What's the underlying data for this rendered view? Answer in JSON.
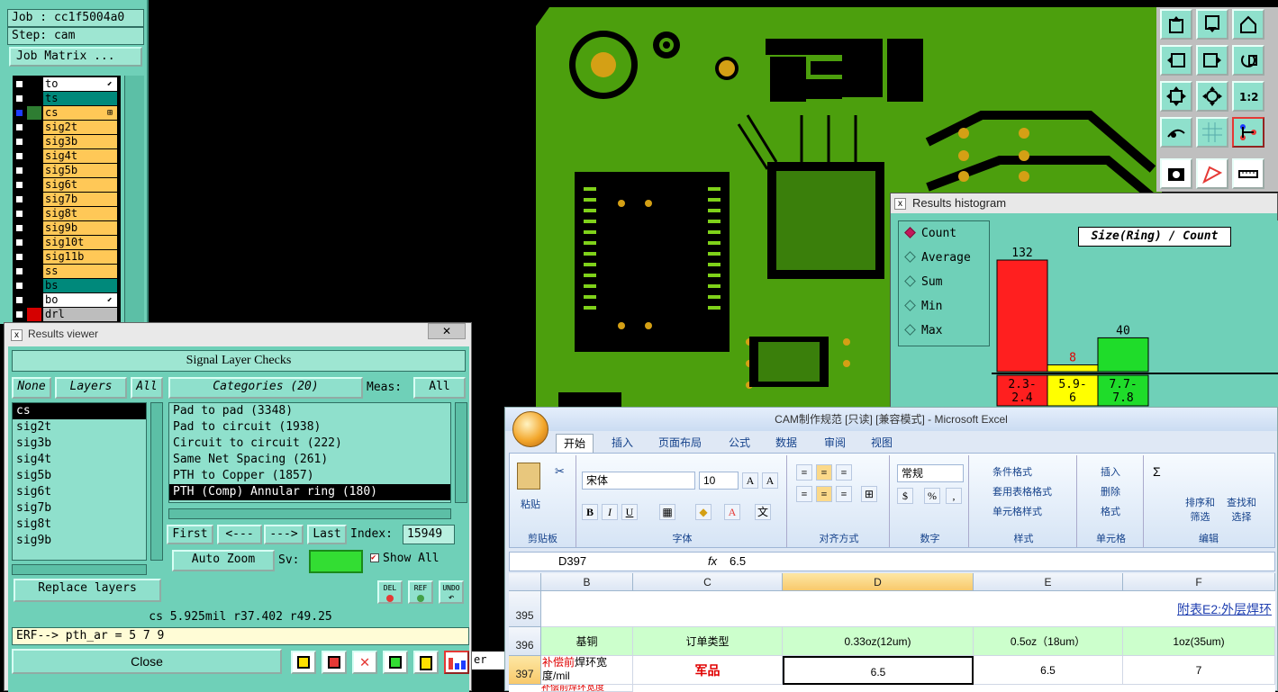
{
  "job_panel": {
    "job": "Job : cc1f5004a0",
    "step": "Step: cam",
    "matrix_button": "Job Matrix ..."
  },
  "layers": [
    {
      "name": "to",
      "color": "#ffffff",
      "swatch": "#000000",
      "flag": "⬋"
    },
    {
      "name": "ts",
      "color": "#00897b",
      "swatch": "#000000",
      "flag": ""
    },
    {
      "name": "cs",
      "color": "#ffc857",
      "swatch": "#2e7d32",
      "flag": "⊞"
    },
    {
      "name": "sig2t",
      "color": "#ffc857",
      "swatch": "#000000",
      "flag": ""
    },
    {
      "name": "sig3b",
      "color": "#ffc857",
      "swatch": "#000000",
      "flag": ""
    },
    {
      "name": "sig4t",
      "color": "#ffc857",
      "swatch": "#000000",
      "flag": ""
    },
    {
      "name": "sig5b",
      "color": "#ffc857",
      "swatch": "#000000",
      "flag": ""
    },
    {
      "name": "sig6t",
      "color": "#ffc857",
      "swatch": "#000000",
      "flag": ""
    },
    {
      "name": "sig7b",
      "color": "#ffc857",
      "swatch": "#000000",
      "flag": ""
    },
    {
      "name": "sig8t",
      "color": "#ffc857",
      "swatch": "#000000",
      "flag": ""
    },
    {
      "name": "sig9b",
      "color": "#ffc857",
      "swatch": "#000000",
      "flag": ""
    },
    {
      "name": "sig10t",
      "color": "#ffc857",
      "swatch": "#000000",
      "flag": ""
    },
    {
      "name": "sig11b",
      "color": "#ffc857",
      "swatch": "#000000",
      "flag": ""
    },
    {
      "name": "ss",
      "color": "#ffc857",
      "swatch": "#000000",
      "flag": ""
    },
    {
      "name": "bs",
      "color": "#00897b",
      "swatch": "#000000",
      "flag": ""
    },
    {
      "name": "bo",
      "color": "#ffffff",
      "swatch": "#000000",
      "flag": "⬋"
    },
    {
      "name": "drl",
      "color": "#bdbdbd",
      "swatch": "#d50000",
      "flag": ""
    }
  ],
  "histogram": {
    "window_title": "Results histogram",
    "close_glyph": "x",
    "caption": "Size(Ring) / Count",
    "options": [
      {
        "label": "Count",
        "selected": true
      },
      {
        "label": "Average",
        "selected": false
      },
      {
        "label": "Sum",
        "selected": false
      },
      {
        "label": "Min",
        "selected": false
      },
      {
        "label": "Max",
        "selected": false
      }
    ]
  },
  "chart_data": {
    "type": "bar",
    "categories": [
      "2.3-2.4",
      "5.9-6",
      "7.7-7.8"
    ],
    "values": [
      132,
      8,
      40
    ],
    "colors": [
      "#ff1f1f",
      "#ffff00",
      "#1fdc2a"
    ],
    "title": "Size(Ring) / Count",
    "ylim": [
      0,
      132
    ]
  },
  "results_viewer": {
    "window_title": "Results viewer",
    "close_glyph": "x",
    "close_x": "✕",
    "panel_title": "Signal Layer Checks",
    "none_btn": "None",
    "layers_btn": "Layers",
    "all_btn": "All",
    "layer_items": [
      "cs",
      "sig2t",
      "sig3b",
      "sig4t",
      "sig5b",
      "sig6t",
      "sig7b",
      "sig8t",
      "sig9b"
    ],
    "categories_label": "Categories (20)",
    "meas_label": "Meas:",
    "meas_value": "All",
    "categories": [
      "Pad to pad (3348)",
      "Pad to circuit (1938)",
      "Circuit to circuit (222)",
      "Same Net Spacing (261)",
      "PTH to Copper (1857)",
      "PTH (Comp) Annular ring (180)"
    ],
    "first_btn": "First",
    "prev_btn": "<---",
    "next_btn": "--->",
    "last_btn": "Last",
    "index_label": "Index:",
    "index_value": "15949",
    "auto_zoom": "Auto Zoom",
    "sv_label": "Sv:",
    "show_all": "Show All",
    "replace_layers": "Replace layers",
    "status_line": "cs 5.925mil  r37.402  r49.25",
    "erf_line": "ERF--> pth_ar = 5 7 9",
    "close_button": "Close",
    "del_label": "DEL",
    "ref_label": "REF",
    "undo_label": "UNDO",
    "hidden_text": "er"
  },
  "excel": {
    "title": "CAM制作规范  [只读]  [兼容模式] - Microsoft Excel",
    "tabs": [
      "开始",
      "插入",
      "页面布局",
      "公式",
      "数据",
      "审阅",
      "视图"
    ],
    "paste": "粘贴",
    "font_name": "宋体",
    "font_size": "10",
    "number_format": "常规",
    "cond_format": "条件格式",
    "table_format": "套用表格格式",
    "cell_style": "单元格样式",
    "insert": "插入",
    "delete": "删除",
    "format": "格式",
    "sort_filter": "排序和\n筛选",
    "find_select": "查找和\n选择",
    "groups": [
      "剪贴板",
      "字体",
      "对齐方式",
      "数字",
      "样式",
      "单元格",
      "编辑"
    ],
    "name_box": "D397",
    "fx": "fx",
    "formula": "6.5",
    "columns": [
      "B",
      "C",
      "D",
      "E",
      "F"
    ],
    "row_numbers": [
      "395",
      "396",
      "397"
    ],
    "link_text": "附表E2:外层焊环",
    "header_row": [
      "基铜",
      "订单类型",
      "0.33oz(12um)",
      "0.5oz（18um）",
      "1oz(35um)"
    ],
    "data_row_b_red": "补偿前",
    "data_row_b": "焊环宽度/mil",
    "data_row": [
      "军品",
      "6.5",
      "6.5",
      "7"
    ],
    "next_row_b": "补偿前焊环宽度"
  }
}
